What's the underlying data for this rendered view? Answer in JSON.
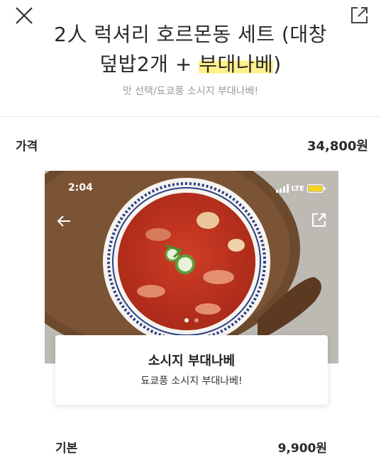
{
  "header": {
    "title_part1": "2人 럭셔리 호르몬동 세트 (대창",
    "title_part2": "덮밥2개 + ",
    "title_highlight": "부대나베",
    "title_part3": ")",
    "subtitle": "맛 선택/됴쿄풍 소시지 부대나베!",
    "close_icon": "close-icon",
    "share_icon": "share-icon"
  },
  "price": {
    "label": "가격",
    "value": "34,800원"
  },
  "photo": {
    "status_time": "2:04",
    "network": "LTE",
    "back_icon": "arrow-left-icon",
    "share_icon": "share-icon",
    "dots_total": 2,
    "dots_active": 0
  },
  "card": {
    "title": "소시지 부대나베",
    "description": "됴쿄풍 소시지 부대나베!"
  },
  "option": {
    "label": "기본",
    "price": "9,900원"
  },
  "colors": {
    "highlight": "#fff08a",
    "battery": "#f7d21b",
    "soup": "#c4331f"
  }
}
